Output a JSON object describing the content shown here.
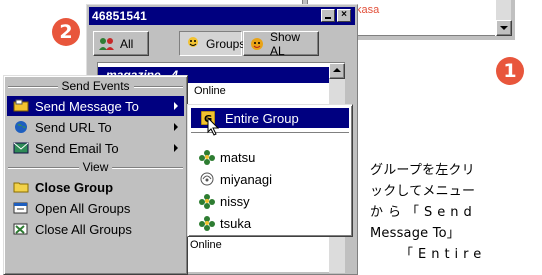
{
  "background_window": {
    "list_text": "kasa"
  },
  "badges": {
    "step1": "1",
    "step2": "2"
  },
  "window": {
    "title": "46851541",
    "minimize_icon": "minimize-icon",
    "close_icon": "close-icon"
  },
  "toolbar": {
    "all_label": "All",
    "groups_label": "Groups",
    "showal_label": "Show AL"
  },
  "list": {
    "selected_group": "magazine - 4",
    "online_label": "Online"
  },
  "context_menu": {
    "header_send_events": "Send Events",
    "send_message": "Send Message To",
    "send_url": "Send URL To",
    "send_email": "Send Email To",
    "header_view": "View",
    "close_group": "Close Group",
    "open_all": "Open All Groups",
    "close_all": "Close All Groups"
  },
  "submenu": {
    "entire_group": "Entire Group",
    "members": [
      "matsu",
      "miyanagi",
      "nissy",
      "tsuka"
    ],
    "online_label": "Online"
  },
  "note": {
    "lines": [
      "グループを左クリ",
      "ックしてメニュー",
      "から「Send",
      "Message To」",
      "「Entire"
    ]
  },
  "colors": {
    "title_bar": "#000080",
    "highlight": "#000080",
    "badge": "#e8563c",
    "face": "#c0c0c0"
  }
}
